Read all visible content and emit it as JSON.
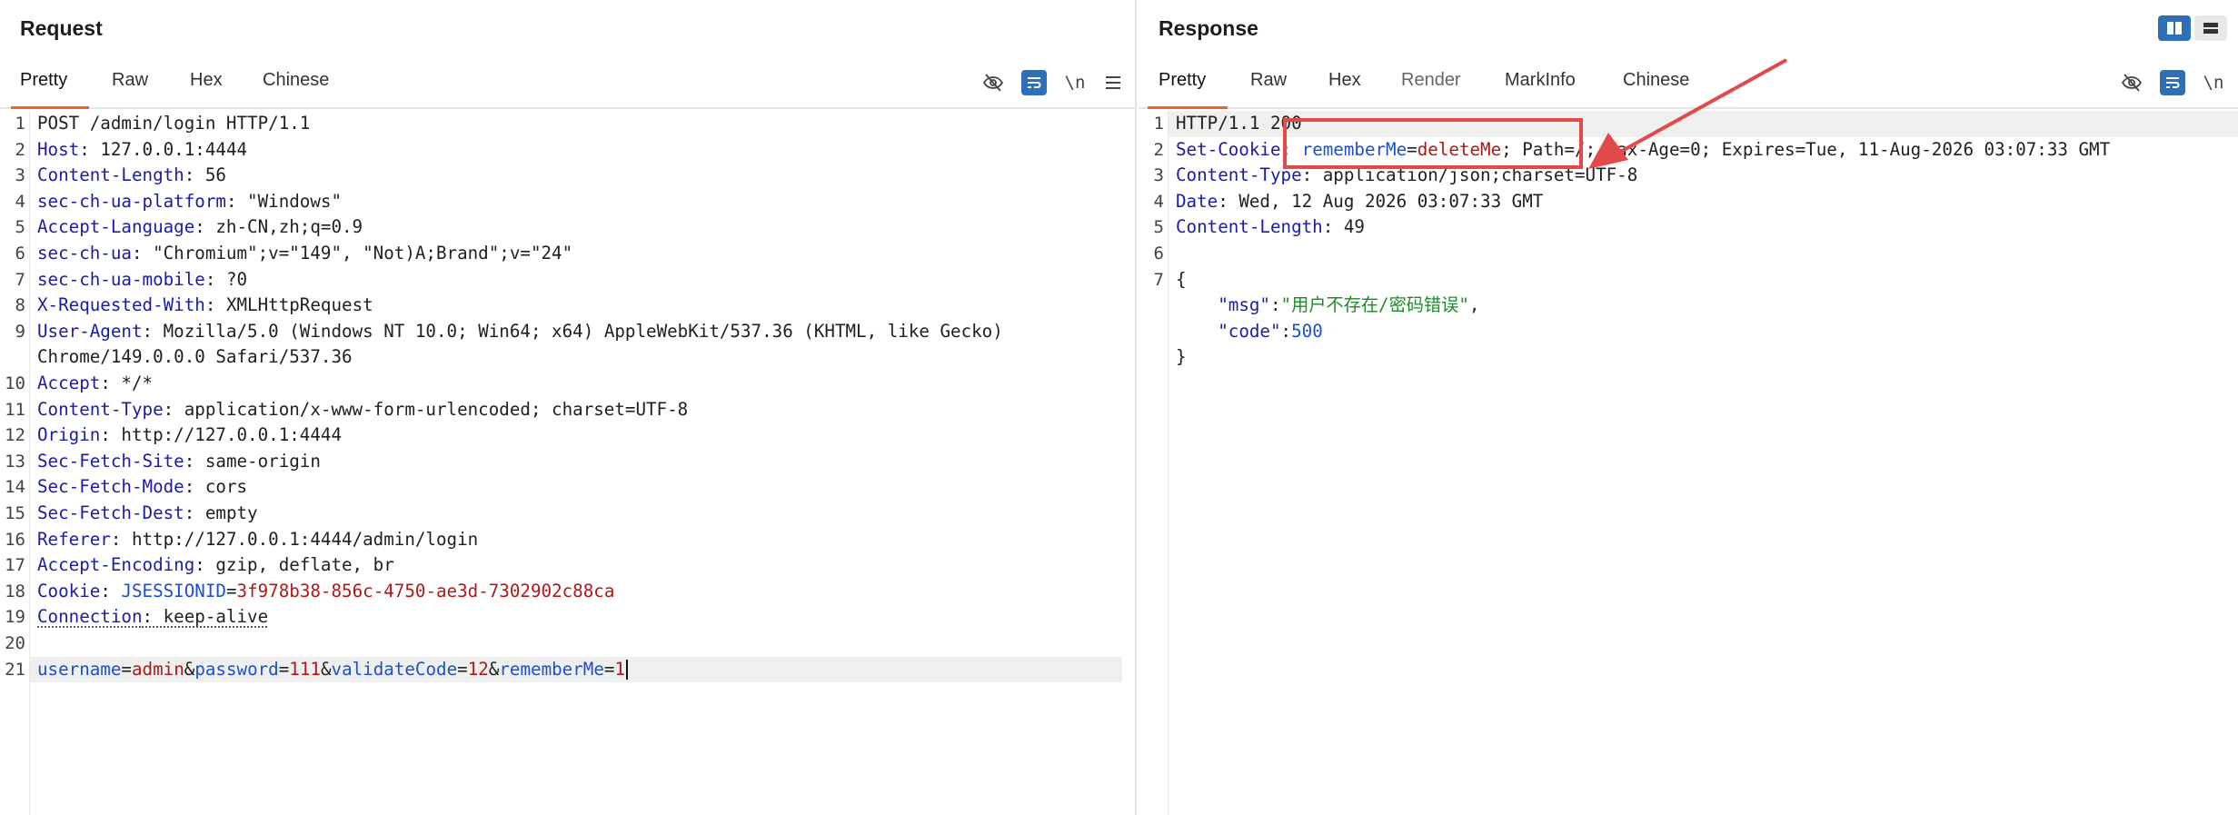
{
  "request": {
    "title": "Request",
    "tabs": [
      "Pretty",
      "Raw",
      "Hex",
      "Chinese"
    ],
    "toolbar": {
      "newline_label": "\\n"
    },
    "lines": [
      {
        "n": "1",
        "parts": [
          [
            "v",
            "POST /admin/login HTTP/1.1"
          ]
        ]
      },
      {
        "n": "2",
        "parts": [
          [
            "k",
            "Host"
          ],
          [
            "v",
            ": 127.0.0.1:4444"
          ]
        ]
      },
      {
        "n": "3",
        "parts": [
          [
            "k",
            "Content-Length"
          ],
          [
            "v",
            ": 56"
          ]
        ]
      },
      {
        "n": "4",
        "parts": [
          [
            "k",
            "sec-ch-ua-platform"
          ],
          [
            "v",
            ": \"Windows\""
          ]
        ]
      },
      {
        "n": "5",
        "parts": [
          [
            "k",
            "Accept-Language"
          ],
          [
            "v",
            ": zh-CN,zh;q=0.9"
          ]
        ]
      },
      {
        "n": "6",
        "parts": [
          [
            "k",
            "sec-ch-ua"
          ],
          [
            "v",
            ": \"Chromium\";v=\"149\", \"Not)A;Brand\";v=\"24\""
          ]
        ]
      },
      {
        "n": "7",
        "parts": [
          [
            "k",
            "sec-ch-ua-mobile"
          ],
          [
            "v",
            ": ?0"
          ]
        ]
      },
      {
        "n": "8",
        "parts": [
          [
            "k",
            "X-Requested-With"
          ],
          [
            "v",
            ": XMLHttpRequest"
          ]
        ]
      },
      {
        "n": "9",
        "parts": [
          [
            "k",
            "User-Agent"
          ],
          [
            "v",
            ": Mozilla/5.0 (Windows NT 10.0; Win64; x64) AppleWebKit/537.36 (KHTML, like Gecko)"
          ]
        ]
      },
      {
        "n": "",
        "parts": [
          [
            "v",
            "Chrome/149.0.0.0 Safari/537.36"
          ]
        ]
      },
      {
        "n": "10",
        "parts": [
          [
            "k",
            "Accept"
          ],
          [
            "v",
            ": */*"
          ]
        ]
      },
      {
        "n": "11",
        "parts": [
          [
            "k",
            "Content-Type"
          ],
          [
            "v",
            ": application/x-www-form-urlencoded; charset=UTF-8"
          ]
        ]
      },
      {
        "n": "12",
        "parts": [
          [
            "k",
            "Origin"
          ],
          [
            "v",
            ": http://127.0.0.1:4444"
          ]
        ]
      },
      {
        "n": "13",
        "parts": [
          [
            "k",
            "Sec-Fetch-Site"
          ],
          [
            "v",
            ": same-origin"
          ]
        ]
      },
      {
        "n": "14",
        "parts": [
          [
            "k",
            "Sec-Fetch-Mode"
          ],
          [
            "v",
            ": cors"
          ]
        ]
      },
      {
        "n": "15",
        "parts": [
          [
            "k",
            "Sec-Fetch-Dest"
          ],
          [
            "v",
            ": empty"
          ]
        ]
      },
      {
        "n": "16",
        "parts": [
          [
            "k",
            "Referer"
          ],
          [
            "v",
            ": http://127.0.0.1:4444/admin/login"
          ]
        ]
      },
      {
        "n": "17",
        "parts": [
          [
            "k",
            "Accept-Encoding"
          ],
          [
            "v",
            ": gzip, deflate, br"
          ]
        ]
      },
      {
        "n": "18",
        "parts": [
          [
            "k",
            "Cookie"
          ],
          [
            "v",
            ": "
          ],
          [
            "n",
            "JSESSIONID"
          ],
          [
            "v",
            "="
          ],
          [
            "r",
            "3f978b38-856c-4750-ae3d-7302902c88ca"
          ]
        ]
      },
      {
        "n": "19",
        "parts": [
          [
            "ku",
            "Connection"
          ],
          [
            "vu",
            ": keep-alive"
          ]
        ]
      },
      {
        "n": "20",
        "parts": []
      },
      {
        "n": "21",
        "highlight": true,
        "caret": true,
        "parts": [
          [
            "n",
            "username"
          ],
          [
            "v",
            "="
          ],
          [
            "r",
            "admin"
          ],
          [
            "v",
            "&"
          ],
          [
            "n",
            "password"
          ],
          [
            "v",
            "="
          ],
          [
            "r",
            "111"
          ],
          [
            "v",
            "&"
          ],
          [
            "n",
            "validateCode"
          ],
          [
            "v",
            "="
          ],
          [
            "r",
            "12"
          ],
          [
            "v",
            "&"
          ],
          [
            "n",
            "rememberMe"
          ],
          [
            "v",
            "="
          ],
          [
            "r",
            "1"
          ]
        ]
      }
    ]
  },
  "response": {
    "title": "Response",
    "tabs": [
      "Pretty",
      "Raw",
      "Hex",
      "Render",
      "MarkInfo",
      "Chinese"
    ],
    "toolbar": {
      "newline_label": "\\n"
    },
    "lines": [
      {
        "n": "1",
        "highlight": true,
        "parts": [
          [
            "v",
            "HTTP/1.1 200"
          ]
        ]
      },
      {
        "n": "2",
        "parts": [
          [
            "k",
            "Set-Cookie"
          ],
          [
            "v",
            ": "
          ],
          [
            "n",
            "rememberMe"
          ],
          [
            "v",
            "="
          ],
          [
            "r",
            "deleteMe"
          ],
          [
            "v",
            "; Path=/; Max-Age=0; Expires=Tue, 11-Aug-2026 03:07:33 GMT"
          ]
        ]
      },
      {
        "n": "3",
        "parts": [
          [
            "k",
            "Content-Type"
          ],
          [
            "v",
            ": application/json;charset=UTF-8"
          ]
        ]
      },
      {
        "n": "4",
        "parts": [
          [
            "k",
            "Date"
          ],
          [
            "v",
            ": Wed, 12 Aug 2026 03:07:33 GMT"
          ]
        ]
      },
      {
        "n": "5",
        "parts": [
          [
            "k",
            "Content-Length"
          ],
          [
            "v",
            ": 49"
          ]
        ]
      },
      {
        "n": "6",
        "parts": []
      },
      {
        "n": "7",
        "parts": [
          [
            "v",
            "{"
          ]
        ]
      },
      {
        "n": "",
        "parts": [
          [
            "v",
            "    "
          ],
          [
            "k",
            "\"msg\""
          ],
          [
            "v",
            ":"
          ],
          [
            "g",
            "\"用户不存在/密码错误\""
          ],
          [
            "v",
            ","
          ]
        ]
      },
      {
        "n": "",
        "parts": [
          [
            "v",
            "    "
          ],
          [
            "k",
            "\"code\""
          ],
          [
            "v",
            ":"
          ],
          [
            "n",
            "500"
          ]
        ]
      },
      {
        "n": "",
        "parts": [
          [
            "v",
            "}"
          ]
        ]
      }
    ]
  },
  "colors": {
    "accent_tab": "#e8622c",
    "annotation": "#e24a4a",
    "toolbar_blue": "#2f6fb8"
  }
}
